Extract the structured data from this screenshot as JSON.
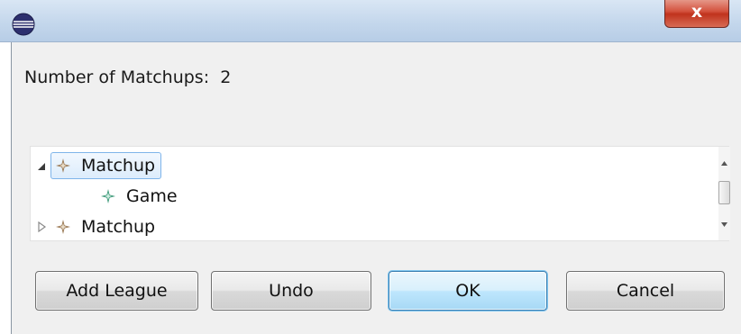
{
  "window": {
    "app_icon": "eclipse-icon",
    "close_label": "x",
    "close_icon": "close-icon"
  },
  "dialog": {
    "matchups_label": "Number of Matchups:",
    "matchups_count": "2"
  },
  "tree": {
    "items": [
      {
        "label": "Matchup",
        "icon": "matchup-node-icon",
        "expanded": true,
        "selected": true,
        "level": 0
      },
      {
        "label": "Game",
        "icon": "game-node-icon",
        "expanded": false,
        "selected": false,
        "level": 1
      },
      {
        "label": "Matchup",
        "icon": "matchup-node-icon",
        "expanded": false,
        "selected": false,
        "level": 0
      }
    ]
  },
  "buttons": {
    "add_league": "Add League",
    "undo": "Undo",
    "ok": "OK",
    "cancel": "Cancel"
  },
  "colors": {
    "matchup_icon": "#9b7a55",
    "game_icon": "#3f9a7a",
    "selection_border": "#7eb4ea",
    "default_button_border": "#3c7fb1",
    "close_button": "#c0331d"
  }
}
